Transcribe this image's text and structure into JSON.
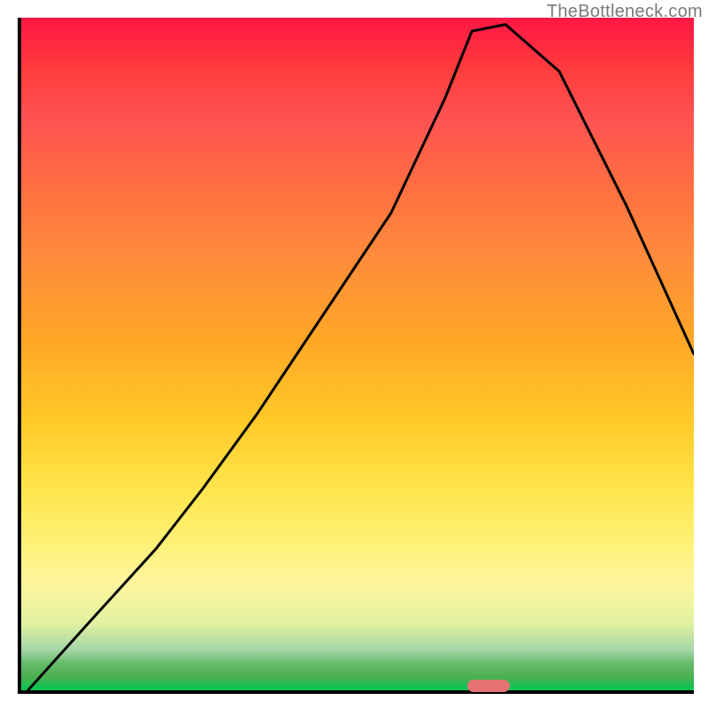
{
  "watermark": "TheBottleneck.com",
  "marker": {
    "x_pct": 69.5,
    "y_pct": 99.3
  },
  "chart_data": {
    "type": "line",
    "title": "",
    "xlabel": "",
    "ylabel": "",
    "xlim": [
      0,
      100
    ],
    "ylim": [
      0,
      100
    ],
    "grid": false,
    "legend": false,
    "series": [
      {
        "name": "bottleneck-curve",
        "x": [
          1,
          10,
          20,
          27,
          35,
          45,
          55,
          63,
          67,
          72,
          80,
          90,
          100
        ],
        "y": [
          0,
          10,
          21,
          30,
          41,
          56,
          71,
          88,
          98,
          99,
          92,
          72,
          50
        ]
      }
    ],
    "marker_point": {
      "x": 69.5,
      "y": 99.3,
      "color": "#e57373"
    },
    "background_gradient": {
      "top": "#ff1744",
      "mid": "#ffca28",
      "bottom": "#00c853"
    }
  }
}
